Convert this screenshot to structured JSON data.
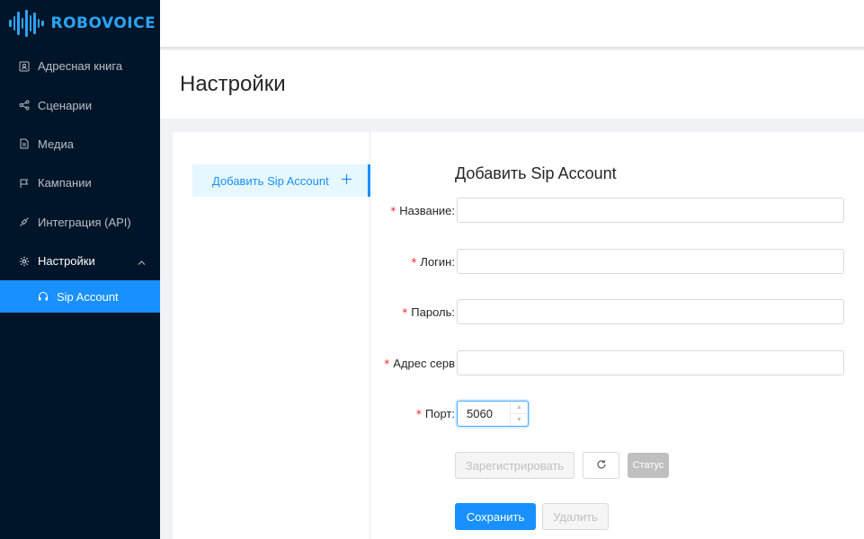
{
  "brand": {
    "name": "ROBOVOICE",
    "accent": "#2aa4f4"
  },
  "sidebar": {
    "items": [
      {
        "label": "Адресная книга",
        "icon": "contact-book-icon"
      },
      {
        "label": "Сценарии",
        "icon": "share-nodes-icon"
      },
      {
        "label": "Медиа",
        "icon": "file-icon"
      },
      {
        "label": "Кампании",
        "icon": "flag-icon"
      },
      {
        "label": "Интеграция (API)",
        "icon": "api-icon"
      },
      {
        "label": "Настройки",
        "icon": "gear-icon"
      }
    ],
    "submenu": {
      "label": "Sip Account",
      "icon": "headset-icon"
    }
  },
  "header": {
    "title": "Настройки"
  },
  "accounts": {
    "add_label": "Добавить Sip Account",
    "add_icon": "plus-icon"
  },
  "form": {
    "title": "Добавить Sip Account",
    "name_label": "Название",
    "name_value": "",
    "login_label": "Логин",
    "login_value": "",
    "password_label": "Пароль",
    "password_value": "",
    "server_label": "Адрес серв",
    "server_value": "",
    "port_label": "Порт",
    "port_value": "5060",
    "required_mark": "*",
    "label_suffix": ":"
  },
  "actions": {
    "register_label": "Зарегистрировать",
    "refresh_icon": "refresh-icon",
    "status_label": "Статус",
    "save_label": "Сохранить",
    "delete_label": "Удалить"
  },
  "colors": {
    "primary": "#1890ff",
    "sidebar_bg": "#001529",
    "required": "#f5222d"
  }
}
